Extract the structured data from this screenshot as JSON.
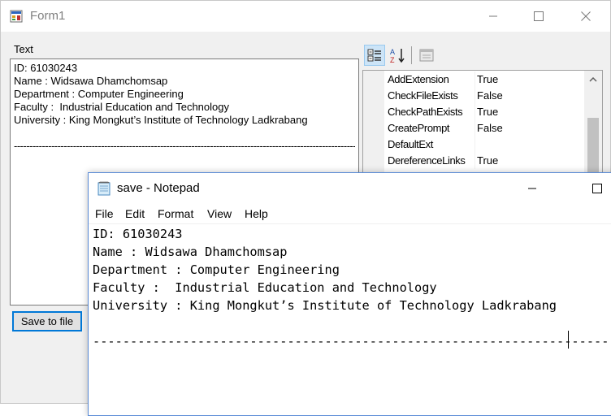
{
  "form1": {
    "title": "Form1",
    "text_label": "Text",
    "textbox_lines": [
      "ID: 61030243",
      "Name : Widsawa Dhamchomsap",
      "Department : Computer Engineering",
      "Faculty :  Industrial Education and Technology",
      "University : King Mongkut’s Institute of Technology Ladkrabang"
    ],
    "textbox_dashes": "--------------------------------------------------------------------------------------------------------------",
    "save_button": "Save to file",
    "property_grid": {
      "rows": [
        {
          "name": "AddExtension",
          "value": "True"
        },
        {
          "name": "CheckFileExists",
          "value": "False"
        },
        {
          "name": "CheckPathExists",
          "value": "True"
        },
        {
          "name": "CreatePrompt",
          "value": "False"
        },
        {
          "name": "DefaultExt",
          "value": ""
        },
        {
          "name": "DereferenceLinks",
          "value": "True"
        }
      ]
    }
  },
  "notepad": {
    "title": "save - Notepad",
    "menu": [
      "File",
      "Edit",
      "Format",
      "View",
      "Help"
    ],
    "lines": [
      "ID: 61030243",
      "Name : Widsawa Dhamchomsap",
      "Department : Computer Engineering",
      "Faculty :  Industrial Education and Technology",
      "University : King Mongkut’s Institute of Technology Ladkrabang"
    ],
    "dashes": "-------------------------------------------------------------------------"
  },
  "colors": {
    "accent": "#0078d7",
    "window_bg": "#f0f0f0",
    "selected_tool": "#cce4f7"
  },
  "icons": {
    "app": "form-app-icon",
    "minimize": "minimize-icon",
    "maximize": "maximize-icon",
    "close": "close-icon",
    "categorized": "categorized-icon",
    "alphabetical": "sort-az-icon",
    "property_pages": "property-pages-icon",
    "notepad": "notepad-icon"
  }
}
